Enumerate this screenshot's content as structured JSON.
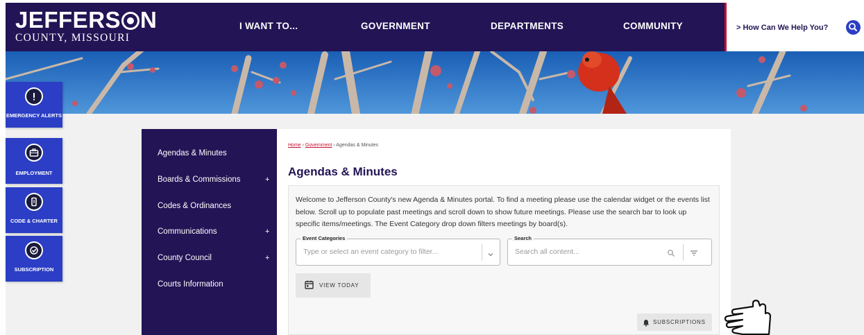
{
  "header": {
    "logo_main_left": "JEFFERS",
    "logo_main_right": "N",
    "logo_sub": "COUNTY, MISSOURI",
    "nav": [
      "I WANT TO...",
      "GOVERNMENT",
      "DEPARTMENTS",
      "COMMUNITY"
    ],
    "help_text": "> How Can We Help You?",
    "search_icon": "search-icon"
  },
  "quick_links": [
    {
      "label": "EMERGENCY ALERTS",
      "icon": "alert-icon"
    },
    {
      "label": "EMPLOYMENT",
      "icon": "briefcase-icon"
    },
    {
      "label": "CODE & CHARTER",
      "icon": "document-icon"
    },
    {
      "label": "SUBSCRIPTION",
      "icon": "checkmark-icon"
    }
  ],
  "sidebar": {
    "items": [
      {
        "label": "Agendas & Minutes",
        "plus": ""
      },
      {
        "label": "Boards & Commissions",
        "plus": "+"
      },
      {
        "label": "Codes & Ordinances",
        "plus": ""
      },
      {
        "label": "Communications",
        "plus": "+"
      },
      {
        "label": "County Council",
        "plus": "+"
      },
      {
        "label": "Courts Information",
        "plus": ""
      }
    ]
  },
  "main": {
    "breadcrumb": {
      "home": "Home",
      "sep1": " › ",
      "government": "Government",
      "sep2": " › ",
      "current": "Agendas & Minutes"
    },
    "title": "Agendas & Minutes",
    "intro": "Welcome to Jefferson County's new Agenda & Minutes portal. To find a meeting please use the calendar widget or the events list below. Scroll up to populate past meetings and scroll down to show future meetings. Please use the search bar to look up specific items/meetings. The Event Category drop down filters meetings by board(s).",
    "event_categories": {
      "label": "Event Categories",
      "placeholder": "Type or select an event category to filter..."
    },
    "search": {
      "label": "Search",
      "placeholder": "Search all content..."
    },
    "view_today": "VIEW TODAY",
    "subscriptions": "SUBSCRIPTIONS"
  },
  "colors": {
    "navy": "#221455",
    "blue": "#2b3ec5",
    "accent_red": "#c8102e",
    "sky": "#1d67bd"
  }
}
